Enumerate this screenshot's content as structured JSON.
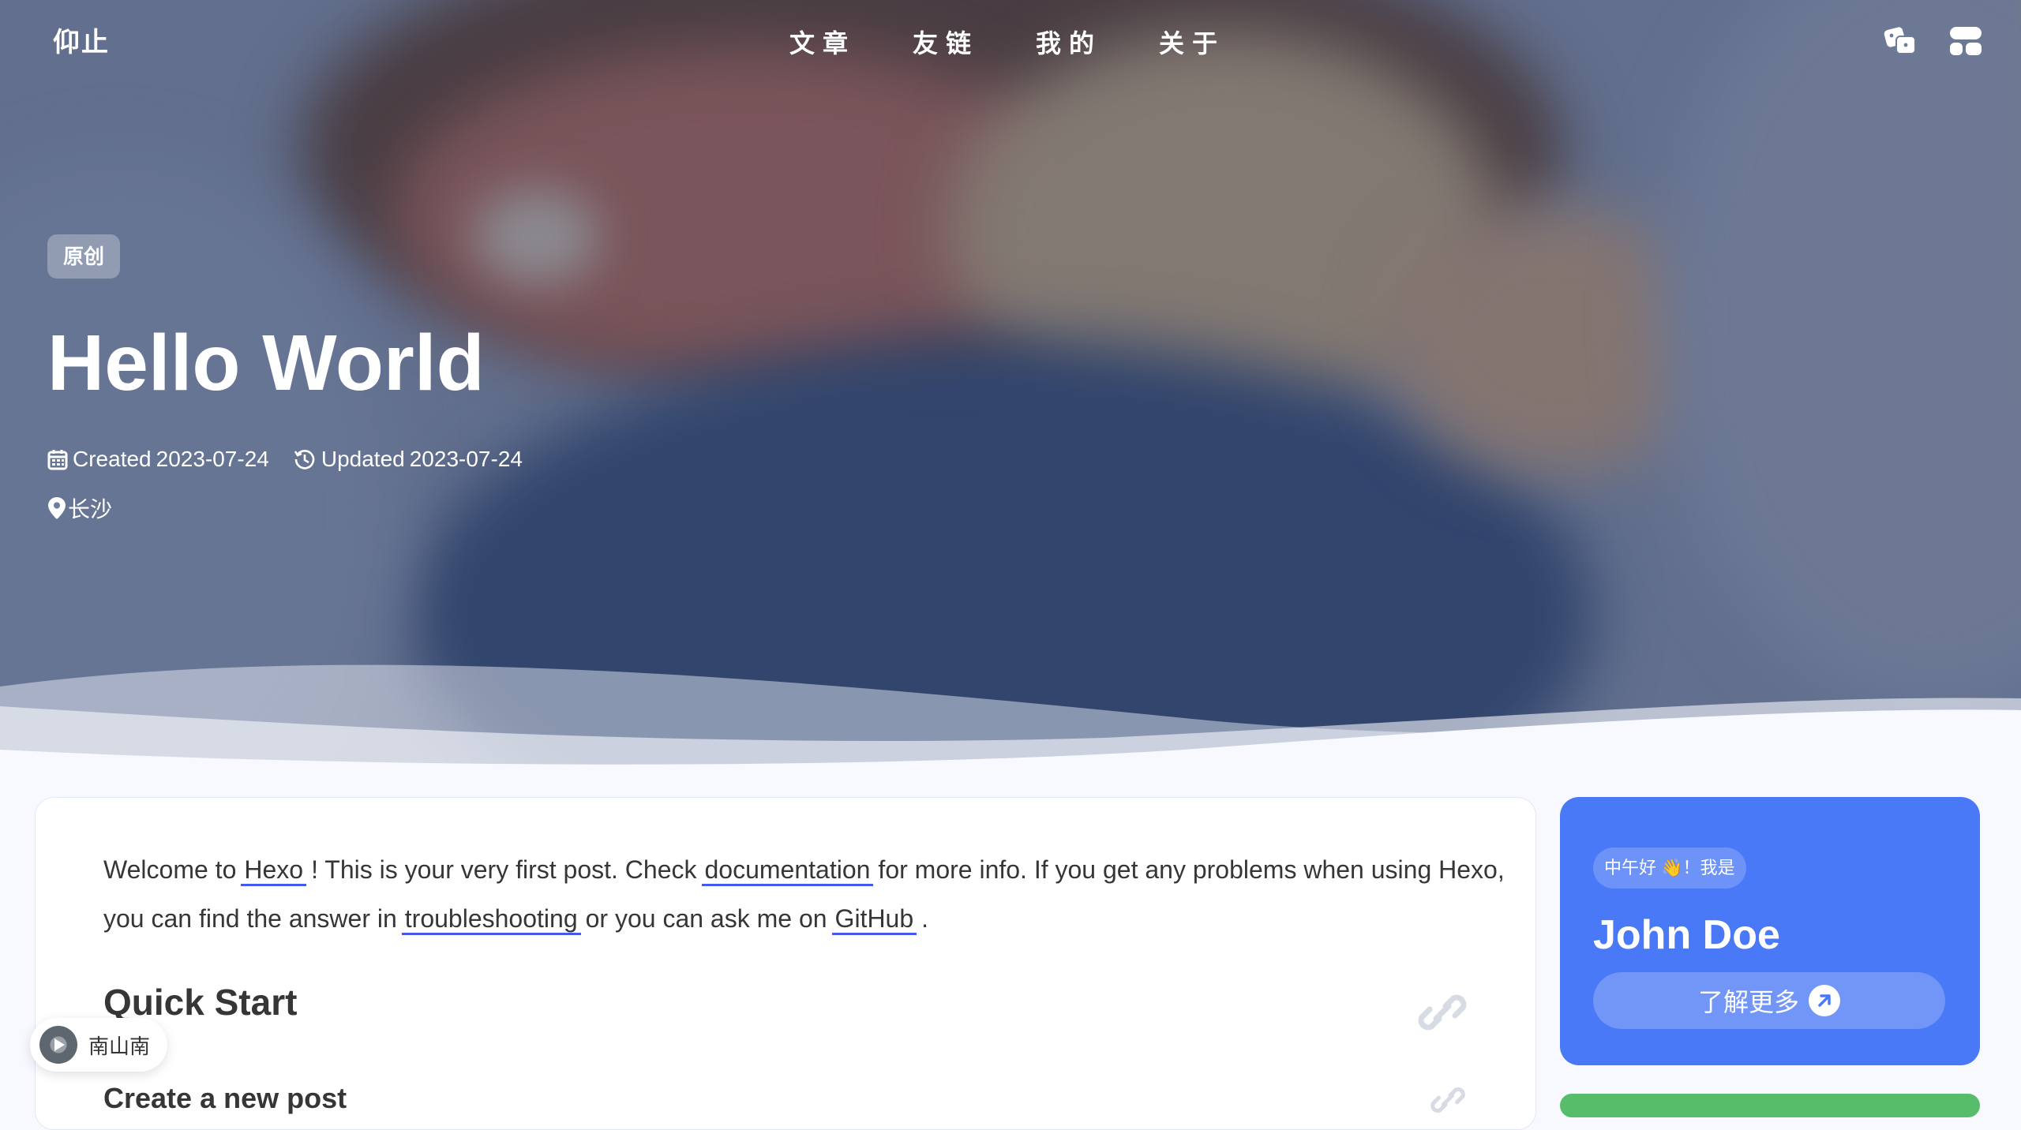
{
  "site": {
    "name": "仰止"
  },
  "nav": {
    "menu": [
      "文章",
      "友链",
      "我的",
      "关于"
    ],
    "icons": [
      "game-dice-icon",
      "grid-menu-icon"
    ]
  },
  "post": {
    "tag": "原创",
    "title": "Hello World",
    "created_label": "Created",
    "created_date": "2023-07-24",
    "updated_label": "Updated",
    "updated_date": "2023-07-24",
    "location": "长沙"
  },
  "content": {
    "p1_a": "Welcome to",
    "link_hexo": "Hexo",
    "p1_b": "! This is your very first post. Check",
    "link_docs": "documentation",
    "p1_c": "for more info. If you get any problems when using Hexo, you can find the answer in",
    "link_trouble": "troubleshooting",
    "p1_d": "or you can ask me on",
    "link_github": "GitHub",
    "p1_e": ".",
    "h2": "Quick Start",
    "h3": "Create a new post"
  },
  "author": {
    "greeting": "中午好 👋！我是",
    "name": "John Doe",
    "more": "了解更多"
  },
  "player": {
    "song": "南山南"
  },
  "colors": {
    "accent": "#425aef",
    "author_card": "#4a79f7",
    "green_card": "#57bd6a"
  }
}
